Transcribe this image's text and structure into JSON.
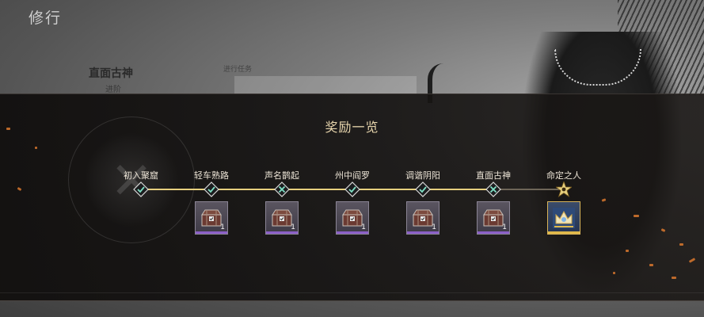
{
  "background": {
    "page_title": "修行",
    "section_title": "直面古神",
    "section_caption": "进阶",
    "radio_label": "进行任务"
  },
  "modal": {
    "title": "奖励一览"
  },
  "progress": {
    "completed_count": 6,
    "total_count": 7
  },
  "milestones": [
    {
      "label": "初入聚窟",
      "icon": "diamond-check-icon",
      "reward": null
    },
    {
      "label": "轻车熟路",
      "icon": "diamond-check-icon",
      "reward": {
        "icon": "chest-icon",
        "count": "1",
        "rarity": "purple"
      }
    },
    {
      "label": "声名鹊起",
      "icon": "diamond-cross-icon",
      "reward": {
        "icon": "chest-icon",
        "count": "1",
        "rarity": "purple"
      }
    },
    {
      "label": "州中阎罗",
      "icon": "diamond-check-icon",
      "reward": {
        "icon": "chest-icon",
        "count": "1",
        "rarity": "purple"
      }
    },
    {
      "label": "调谐阴阳",
      "icon": "diamond-check-icon",
      "reward": {
        "icon": "chest-icon",
        "count": "1",
        "rarity": "purple"
      }
    },
    {
      "label": "直面古神",
      "icon": "diamond-cross-icon",
      "reward": {
        "icon": "chest-icon",
        "count": "1",
        "rarity": "purple"
      }
    },
    {
      "label": "命定之人",
      "icon": "star-emblem-icon",
      "reward": {
        "icon": "crown-portrait-icon",
        "count": "",
        "rarity": "gold"
      }
    }
  ],
  "colors": {
    "gold_accent": "#e6cf7e",
    "purple_rarity": "#8b5fc7",
    "title_text": "#e8d6ad"
  }
}
